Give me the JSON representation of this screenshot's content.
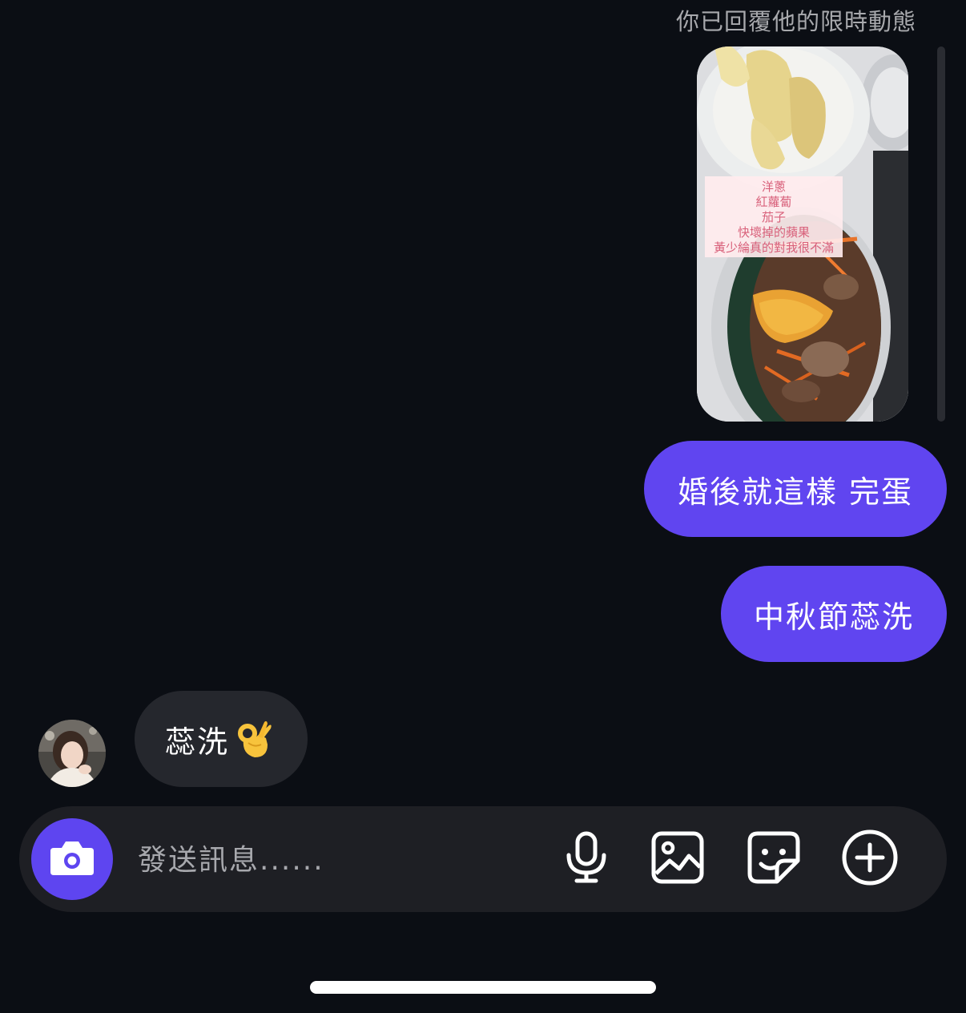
{
  "story_reply": {
    "note": "你已回覆他的限時動態",
    "caption_lines": [
      "洋蔥",
      "紅蘿蔔",
      "茄子",
      "快壞掉的蘋果",
      "黃少綸真的對我很不滿"
    ]
  },
  "messages": {
    "sent": [
      {
        "text": "婚後就這樣 完蛋"
      },
      {
        "text": "中秋節蕊洗"
      }
    ],
    "received": [
      {
        "text": "蕊洗",
        "emoji": "ok-hand-emoji"
      }
    ]
  },
  "composer": {
    "placeholder": "發送訊息......",
    "value": "",
    "icons": [
      "camera-icon",
      "microphone-icon",
      "image-icon",
      "sticker-icon",
      "plus-icon"
    ]
  },
  "colors": {
    "background": "#0b0e14",
    "sent_bubble": "#6045f0",
    "received_bubble": "#25272d",
    "composer": "#1e1f24",
    "camera_button": "#5e45f0",
    "secondary_text": "#a8a9ad"
  }
}
